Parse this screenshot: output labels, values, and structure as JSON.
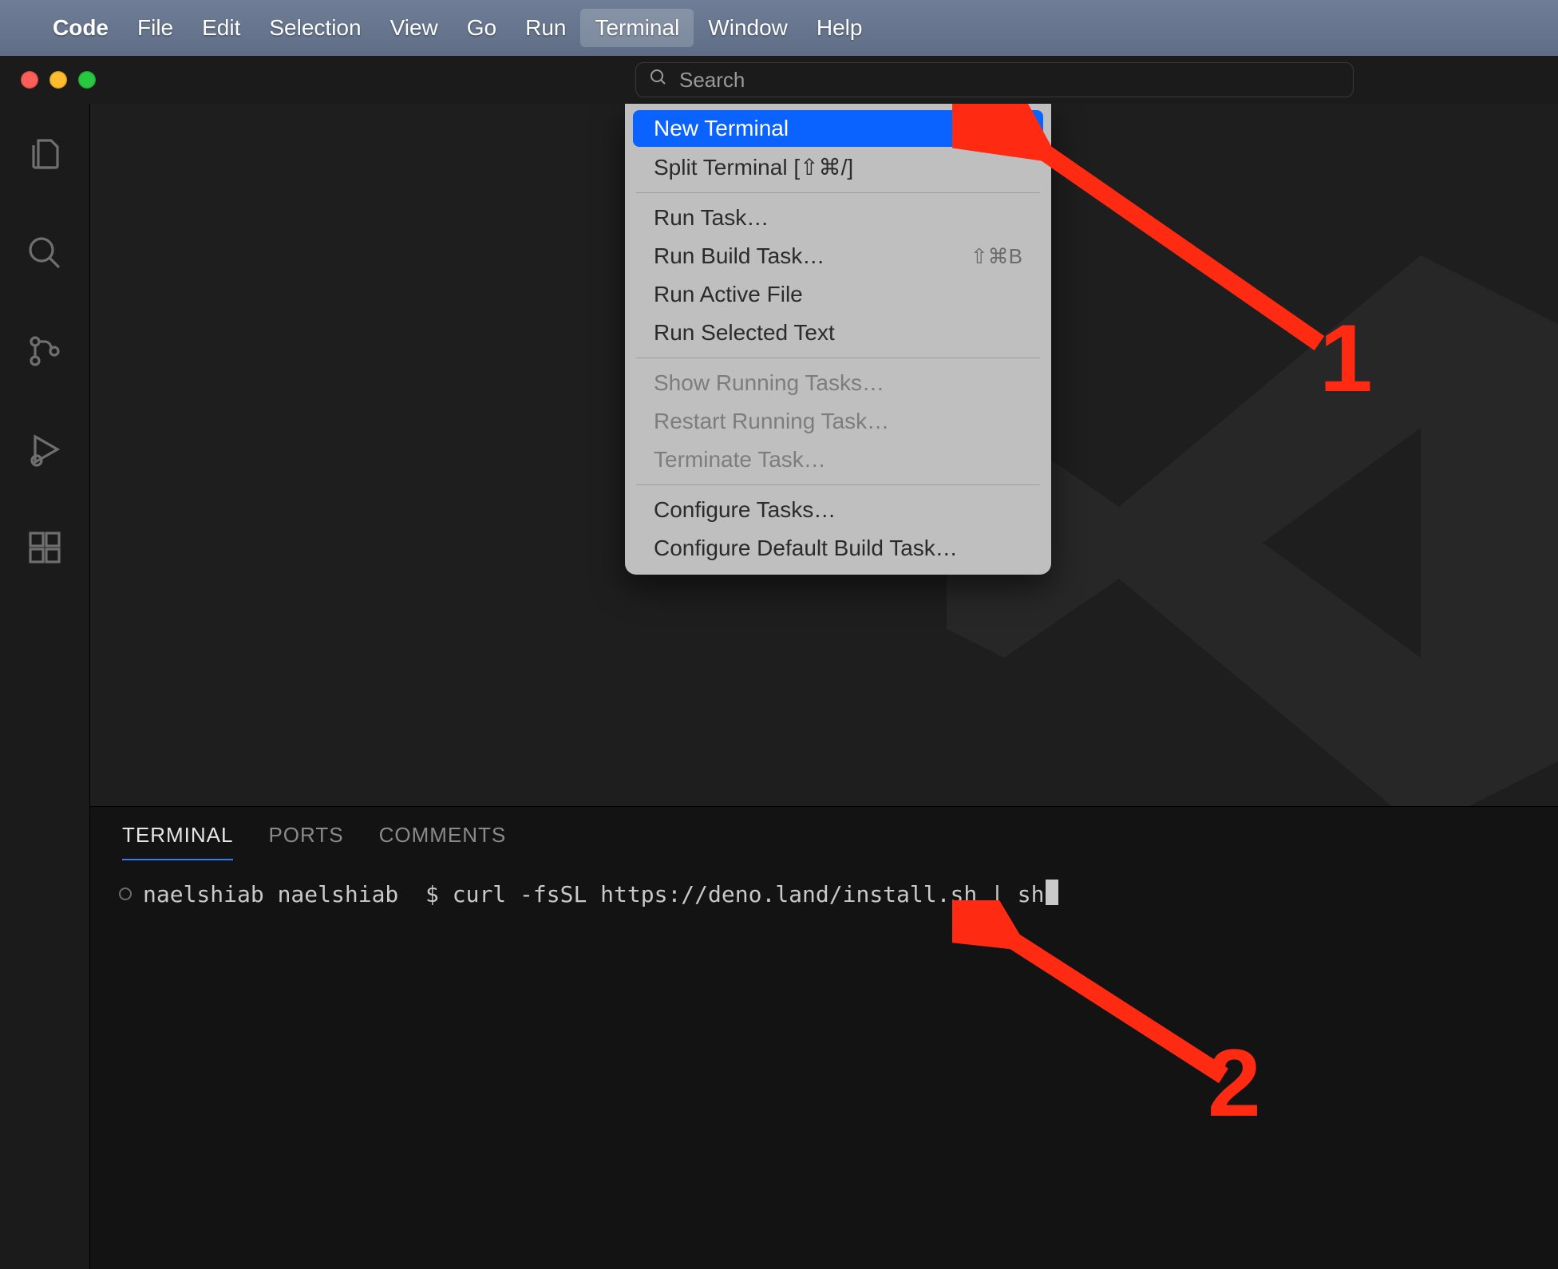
{
  "menubar": {
    "app": "Code",
    "items": [
      "File",
      "Edit",
      "Selection",
      "View",
      "Go",
      "Run",
      "Terminal",
      "Window",
      "Help"
    ],
    "active_index": 6
  },
  "search": {
    "placeholder": "Search"
  },
  "dropdown": {
    "groups": [
      [
        {
          "label": "New Terminal",
          "shortcut": "",
          "disabled": false,
          "highlight": true
        },
        {
          "label": "Split Terminal [⇧⌘/]",
          "shortcut": "",
          "disabled": false,
          "highlight": false
        }
      ],
      [
        {
          "label": "Run Task…",
          "shortcut": "",
          "disabled": false,
          "highlight": false
        },
        {
          "label": "Run Build Task…",
          "shortcut": "⇧⌘B",
          "disabled": false,
          "highlight": false
        },
        {
          "label": "Run Active File",
          "shortcut": "",
          "disabled": false,
          "highlight": false
        },
        {
          "label": "Run Selected Text",
          "shortcut": "",
          "disabled": false,
          "highlight": false
        }
      ],
      [
        {
          "label": "Show Running Tasks…",
          "shortcut": "",
          "disabled": true,
          "highlight": false
        },
        {
          "label": "Restart Running Task…",
          "shortcut": "",
          "disabled": true,
          "highlight": false
        },
        {
          "label": "Terminate Task…",
          "shortcut": "",
          "disabled": true,
          "highlight": false
        }
      ],
      [
        {
          "label": "Configure Tasks…",
          "shortcut": "",
          "disabled": false,
          "highlight": false
        },
        {
          "label": "Configure Default Build Task…",
          "shortcut": "",
          "disabled": false,
          "highlight": false
        }
      ]
    ]
  },
  "panel": {
    "tabs": [
      "TERMINAL",
      "PORTS",
      "COMMENTS"
    ],
    "active_index": 0,
    "terminal": {
      "prompt": "naelshiab naelshiab  $ ",
      "command": "curl -fsSL https://deno.land/install.sh | sh"
    }
  },
  "annotations": {
    "one": "1",
    "two": "2"
  }
}
